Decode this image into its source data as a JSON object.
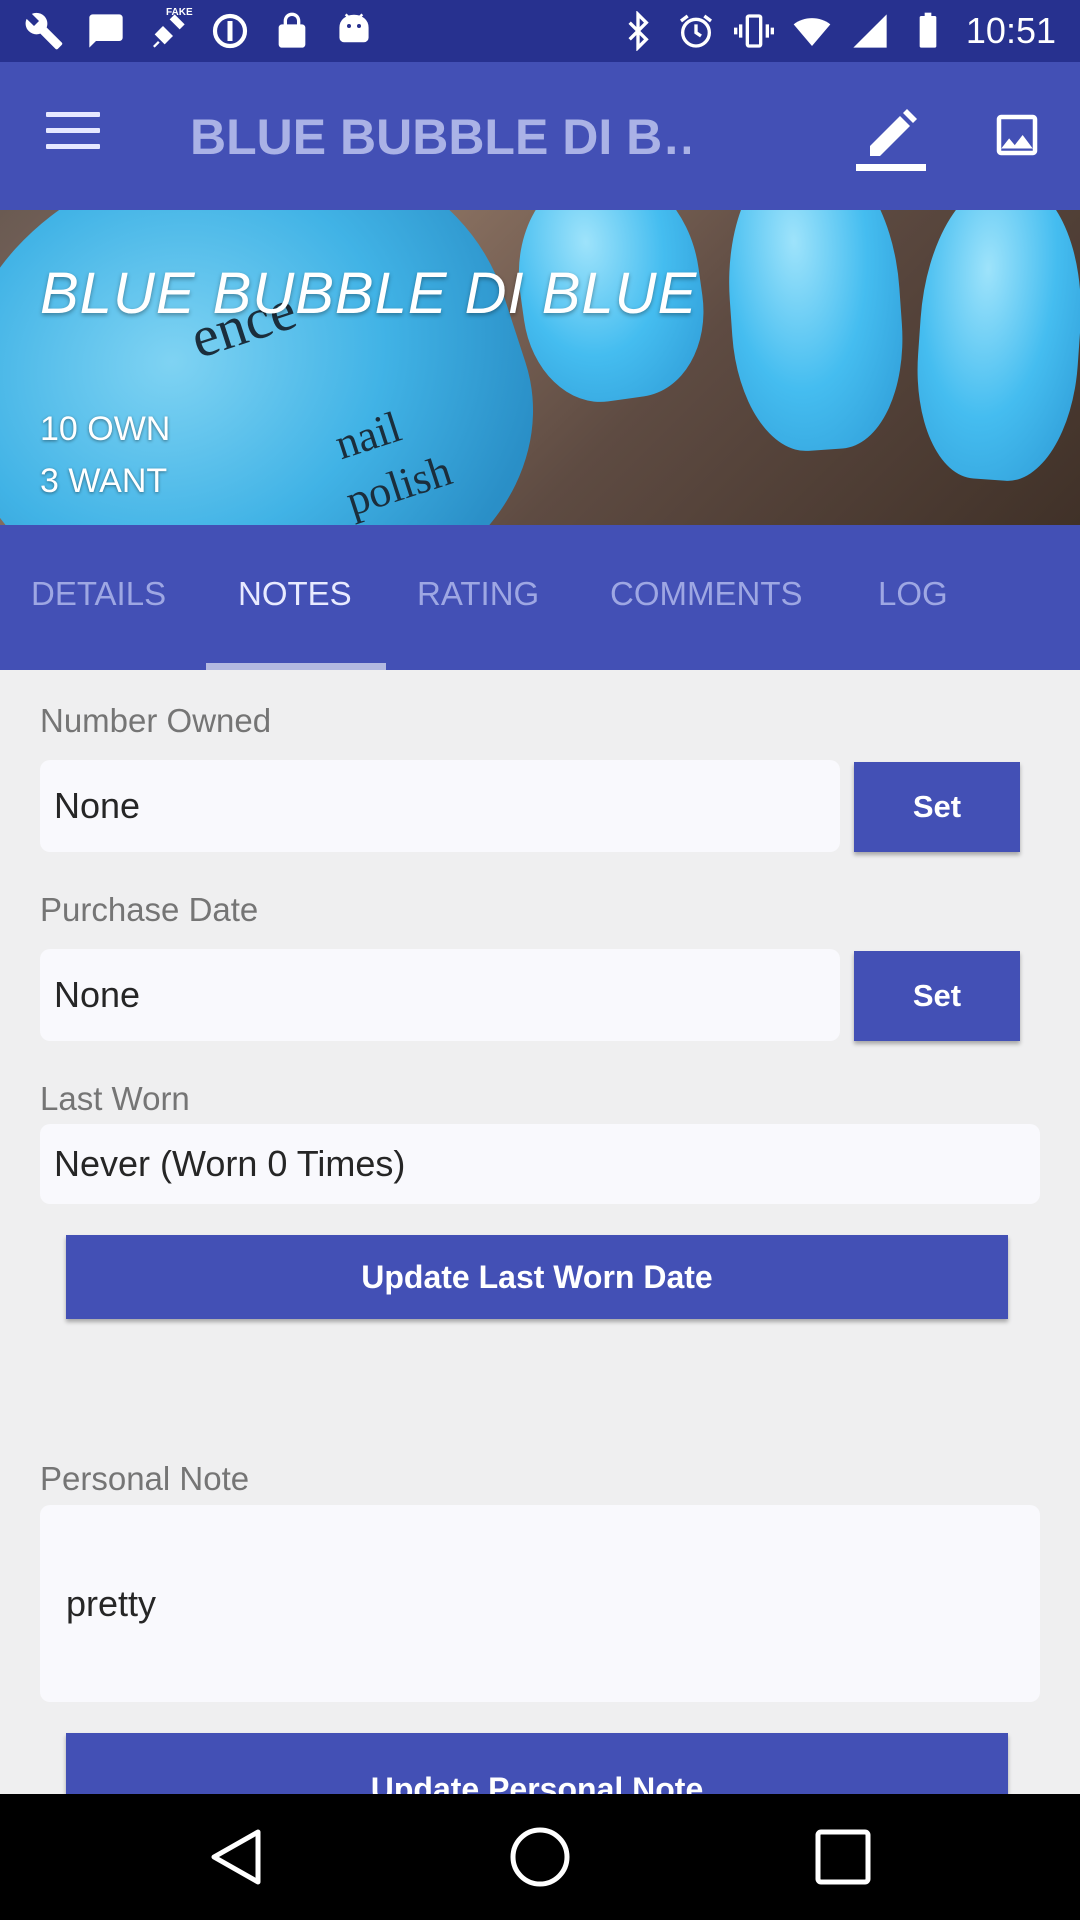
{
  "status_bar": {
    "time": "10:51",
    "left_icons": [
      "wrench-icon",
      "message-icon",
      "satellite-icon",
      "sync-icon",
      "lock-icon",
      "android-icon"
    ],
    "right_icons": [
      "bluetooth-icon",
      "alarm-icon",
      "vibrate-icon",
      "wifi-icon",
      "signal-icon",
      "battery-icon"
    ],
    "satellite_badge": "FAKE"
  },
  "app_bar": {
    "title": "BLUE BUBBLE DI B…",
    "menu_icon": "menu-icon",
    "edit_icon": "pencil-icon",
    "image_icon": "image-icon"
  },
  "hero": {
    "title": "BLUE BUBBLE DI BLUE",
    "own": "10 OWN",
    "want": "3 WANT",
    "bottle_text": [
      "ence",
      "nail",
      "polish"
    ]
  },
  "tabs": [
    {
      "label": "DETAILS",
      "active": false
    },
    {
      "label": "NOTES",
      "active": true
    },
    {
      "label": "RATING",
      "active": false
    },
    {
      "label": "COMMENTS",
      "active": false
    },
    {
      "label": "LOG",
      "active": false
    }
  ],
  "notes": {
    "number_owned": {
      "label": "Number Owned",
      "value": "None",
      "button": "Set"
    },
    "purchase_date": {
      "label": "Purchase Date",
      "value": "None",
      "button": "Set"
    },
    "last_worn": {
      "label": "Last Worn",
      "value": "Never  (Worn 0 Times)",
      "button": "Update Last Worn Date"
    },
    "personal_note": {
      "label": "Personal Note",
      "value": "pretty",
      "button": "Update Personal Note"
    }
  },
  "colors": {
    "primary": "#4350b5",
    "status_bar": "#27318f",
    "background": "#efeff0"
  }
}
